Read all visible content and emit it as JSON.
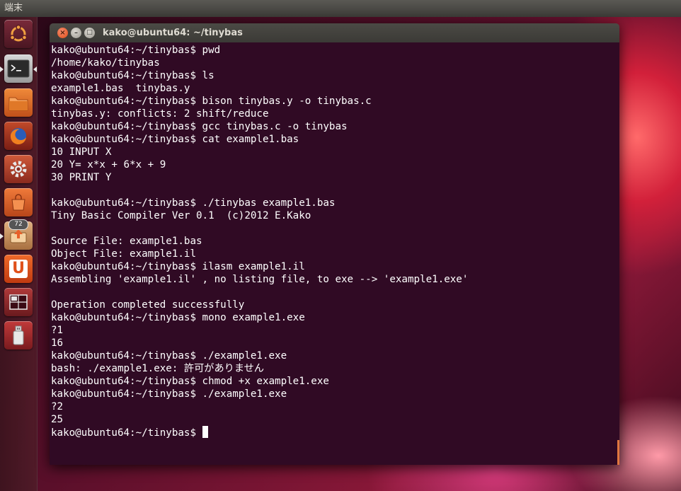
{
  "top_panel": {
    "title": "端末"
  },
  "launcher": {
    "items": [
      {
        "name": "dash-home",
        "icon": "ubuntu-logo-icon"
      },
      {
        "name": "terminal",
        "icon": "terminal-icon",
        "active": true
      },
      {
        "name": "files",
        "icon": "folder-icon"
      },
      {
        "name": "firefox",
        "icon": "firefox-icon"
      },
      {
        "name": "system-settings",
        "icon": "gear-wrench-icon"
      },
      {
        "name": "software-center",
        "icon": "shopping-bag-icon"
      },
      {
        "name": "update-manager",
        "icon": "update-icon",
        "badge": "72"
      },
      {
        "name": "ubuntu-one",
        "icon": "ubuntu-one-icon",
        "label": "U"
      },
      {
        "name": "workspace-switcher",
        "icon": "workspaces-icon"
      },
      {
        "name": "usb-drive",
        "icon": "usb-drive-icon"
      }
    ]
  },
  "window": {
    "title": "kako@ubuntu64: ~/tinybas",
    "buttons": {
      "close": "×",
      "minimize": "–",
      "maximize": "□"
    }
  },
  "terminal": {
    "colors": {
      "background": "#300a24",
      "foreground": "#ffffff"
    },
    "lines": [
      "kako@ubuntu64:~/tinybas$ pwd",
      "/home/kako/tinybas",
      "kako@ubuntu64:~/tinybas$ ls",
      "example1.bas  tinybas.y",
      "kako@ubuntu64:~/tinybas$ bison tinybas.y -o tinybas.c",
      "tinybas.y: conflicts: 2 shift/reduce",
      "kako@ubuntu64:~/tinybas$ gcc tinybas.c -o tinybas",
      "kako@ubuntu64:~/tinybas$ cat example1.bas",
      "10 INPUT X",
      "20 Y= x*x + 6*x + 9",
      "30 PRINT Y",
      "",
      "kako@ubuntu64:~/tinybas$ ./tinybas example1.bas",
      "Tiny Basic Compiler Ver 0.1  (c)2012 E.Kako",
      "",
      "Source File: example1.bas",
      "Object File: example1.il",
      "kako@ubuntu64:~/tinybas$ ilasm example1.il",
      "Assembling 'example1.il' , no listing file, to exe --> 'example1.exe'",
      "",
      "Operation completed successfully",
      "kako@ubuntu64:~/tinybas$ mono example1.exe",
      "?1",
      "16",
      "kako@ubuntu64:~/tinybas$ ./example1.exe",
      "bash: ./example1.exe: 許可がありません",
      "kako@ubuntu64:~/tinybas$ chmod +x example1.exe",
      "kako@ubuntu64:~/tinybas$ ./example1.exe",
      "?2",
      "25"
    ],
    "prompt": "kako@ubuntu64:~/tinybas$ "
  }
}
